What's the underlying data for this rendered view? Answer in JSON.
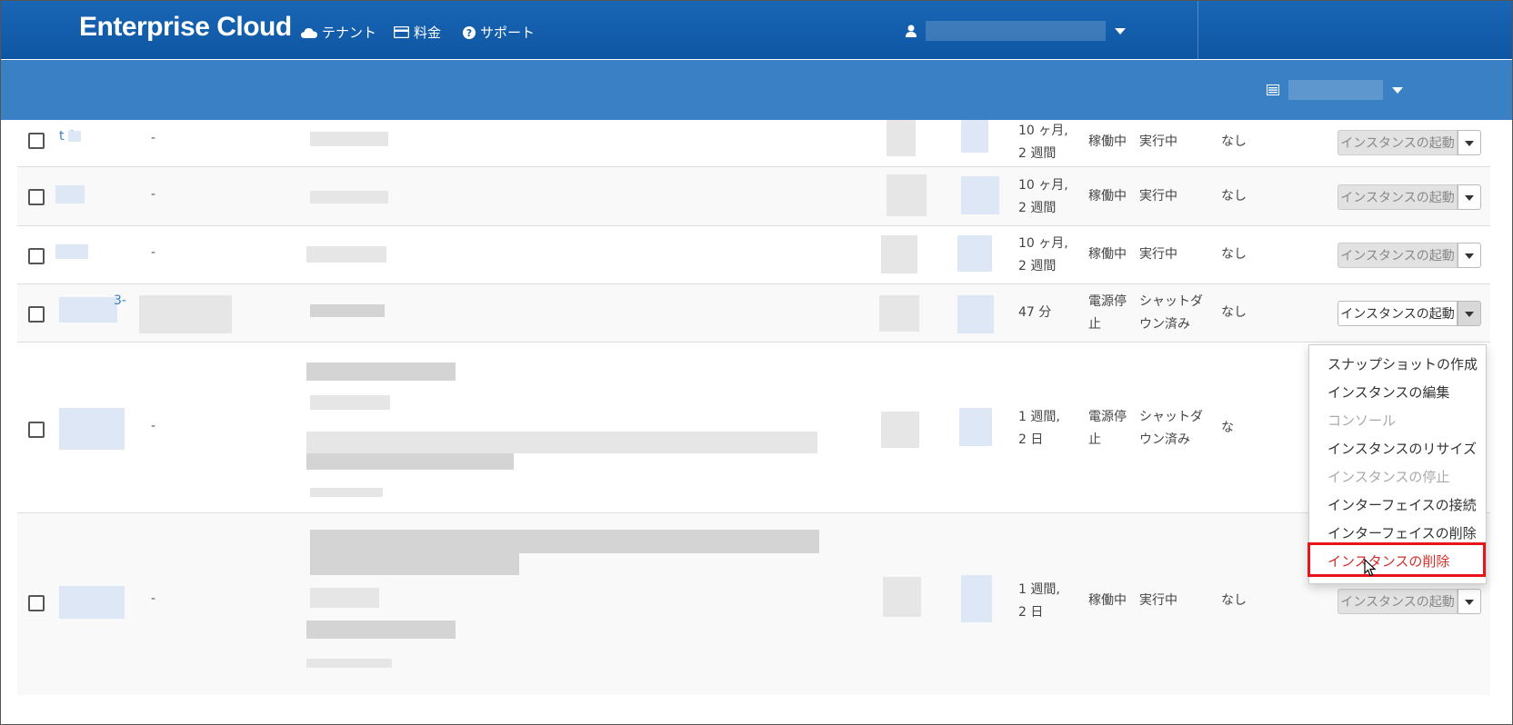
{
  "header": {
    "brand": "Enterprise Cloud",
    "nav": [
      {
        "icon": "cloud-icon",
        "label": "テナント"
      },
      {
        "icon": "credit-card-icon",
        "label": "料金"
      },
      {
        "icon": "question-circle-icon",
        "label": "サポート"
      }
    ],
    "user_icon": "user-icon"
  },
  "subbar": {
    "icon": "list-icon"
  },
  "table": {
    "rows": [
      {
        "id": "t  1",
        "dash": "-",
        "age": "10 ヶ月,\n2 週間",
        "power": "稼働中",
        "status": "実行中",
        "lock": "なし",
        "action": "インスタンスの起動"
      },
      {
        "id": "",
        "dash": "-",
        "age": "10 ヶ月,\n2 週間",
        "power": "稼働中",
        "status": "実行中",
        "lock": "なし",
        "action": "インスタンスの起動"
      },
      {
        "id": "",
        "dash": "-",
        "age": "10 ヶ月,\n2 週間",
        "power": "稼働中",
        "status": "実行中",
        "lock": "なし",
        "action": "インスタンスの起動"
      },
      {
        "id": "3-",
        "dash": "",
        "age": "47 分",
        "power": "電源停\n止",
        "status": "シャットダ\nウン済み",
        "lock": "なし",
        "action": "インスタンスの起動"
      },
      {
        "id": "",
        "dash": "-",
        "age": "1 週間,\n2 日",
        "power": "電源停\n止",
        "status": "シャットダ\nウン済み",
        "lock": "な",
        "action": ""
      },
      {
        "id": "",
        "dash": "-",
        "age": "1 週間,\n2 日",
        "power": "稼働中",
        "status": "実行中",
        "lock": "なし",
        "action": "インスタンスの起動"
      }
    ]
  },
  "dropdown": {
    "items": [
      {
        "label": "スナップショットの作成",
        "state": "enabled"
      },
      {
        "label": "インスタンスの編集",
        "state": "enabled"
      },
      {
        "label": "コンソール",
        "state": "disabled"
      },
      {
        "label": "インスタンスのリサイズ",
        "state": "enabled"
      },
      {
        "label": "インスタンスの停止",
        "state": "disabled"
      },
      {
        "label": "インターフェイスの接続",
        "state": "enabled"
      },
      {
        "label": "インターフェイスの削除",
        "state": "enabled"
      },
      {
        "label": "インスタンスの削除",
        "state": "danger"
      }
    ]
  },
  "colors": {
    "header": "#1966b5",
    "subbar": "#3a80c4",
    "danger": "#d0302b",
    "highlight": "#e8141c",
    "link": "#3a7fc1"
  }
}
